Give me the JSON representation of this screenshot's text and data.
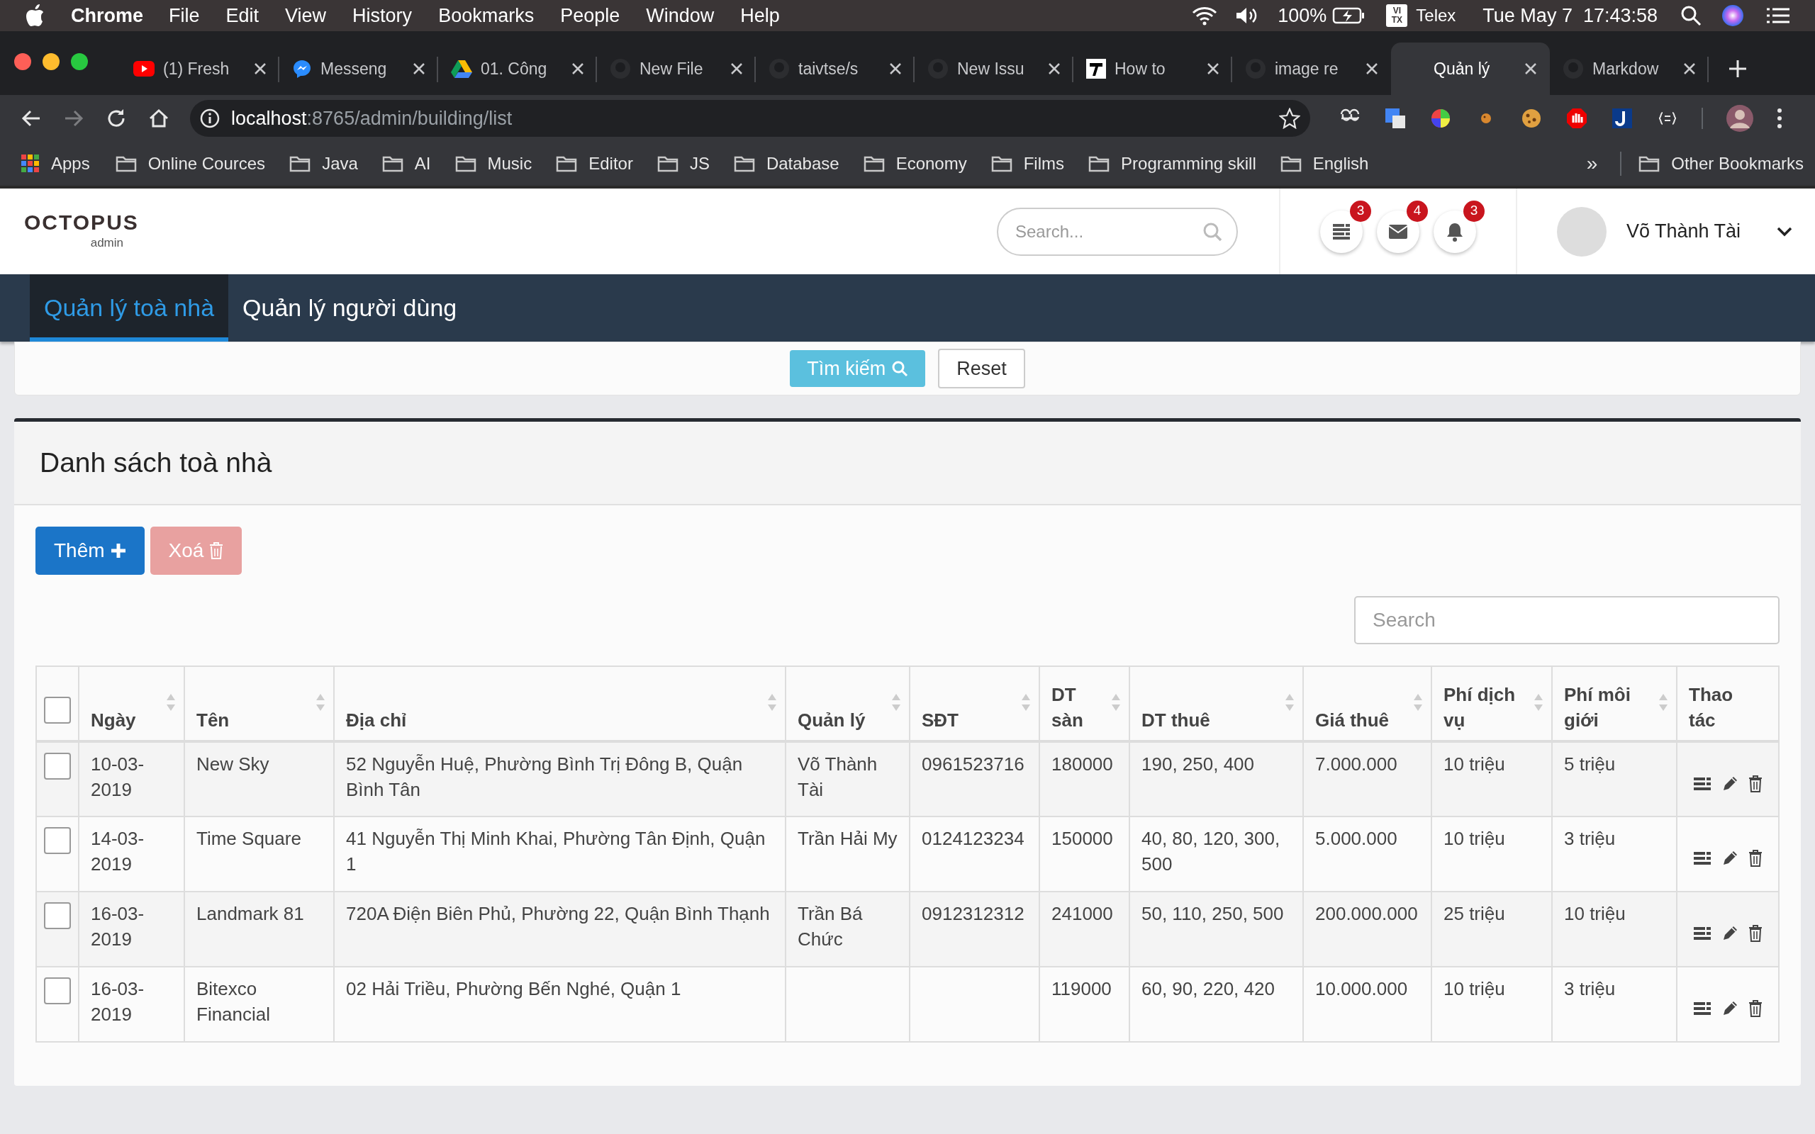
{
  "menubar": {
    "app": "Chrome",
    "menus": [
      "File",
      "Edit",
      "View",
      "History",
      "Bookmarks",
      "People",
      "Window",
      "Help"
    ],
    "battery": "100%",
    "input_badge": [
      "VI",
      "TX"
    ],
    "input_method": "Telex",
    "clock": "Tue May 7  17:43:58"
  },
  "tabs": [
    {
      "title": "(1) Fresh",
      "kind": "video",
      "selected": false
    },
    {
      "title": "Messeng",
      "kind": "chat",
      "selected": false
    },
    {
      "title": "01. Công",
      "kind": "drive",
      "selected": false
    },
    {
      "title": "New File",
      "kind": "repo",
      "selected": false
    },
    {
      "title": "taivtse/s",
      "kind": "repo",
      "selected": false
    },
    {
      "title": "New Issu",
      "kind": "repo",
      "selected": false
    },
    {
      "title": "How to",
      "kind": "letter",
      "selected": false
    },
    {
      "title": "image re",
      "kind": "repo",
      "selected": false
    },
    {
      "title": "Quản lý",
      "kind": "blank",
      "selected": true
    },
    {
      "title": "Markdow",
      "kind": "repo",
      "selected": false
    }
  ],
  "address": {
    "host": "localhost",
    "path": ":8765/admin/building/list"
  },
  "bookmarks": {
    "apps": "Apps",
    "folders": [
      "Online Cources",
      "Java",
      "AI",
      "Music",
      "Editor",
      "JS",
      "Database",
      "Economy",
      "Films",
      "Programming skill",
      "English"
    ],
    "overflow": "»",
    "other": "Other Bookmarks"
  },
  "header": {
    "logo": "OCTOPUS",
    "logo_sub": "admin",
    "search_placeholder": "Search...",
    "notifications": [
      {
        "kind": "list",
        "count": "3"
      },
      {
        "kind": "mail",
        "count": "4"
      },
      {
        "kind": "bell",
        "count": "3"
      }
    ],
    "user": "Võ Thành Tài"
  },
  "nav": [
    {
      "label": "Quản lý toà nhà",
      "selected": true
    },
    {
      "label": "Quản lý người dùng",
      "selected": false
    }
  ],
  "search_panel": {
    "buttons": [
      "Tìm kiếm",
      "Reset"
    ]
  },
  "card": {
    "title": "Danh sách toà nhà",
    "add_button": "Thêm",
    "delete_button": {
      "label": "Xoá",
      "disabled": true
    },
    "search_placeholder": "Search"
  },
  "table": {
    "all_checked": false,
    "columns": [
      {
        "label": "Ngày",
        "sortable": true
      },
      {
        "label": "Tên",
        "sortable": true
      },
      {
        "label": "Địa chỉ",
        "sortable": true
      },
      {
        "label": "Quản lý",
        "sortable": true
      },
      {
        "label": "SĐT",
        "sortable": true
      },
      {
        "label": "DT sàn",
        "sortable": true
      },
      {
        "label": "DT thuê",
        "sortable": true
      },
      {
        "label": "Giá thuê",
        "sortable": true
      },
      {
        "label": "Phí dịch vụ",
        "sortable": true
      },
      {
        "label": "Phí môi giới",
        "sortable": true
      },
      {
        "label": "Thao tác",
        "sortable": false
      }
    ],
    "rows": [
      {
        "checked": false,
        "cells": [
          "10-03-2019",
          "New Sky",
          "52 Nguyễn Huệ, Phường Bình Trị Đông B, Quận Bình Tân",
          "Võ Thành Tài",
          "0961523716",
          "180000",
          "190, 250, 400",
          "7.000.000",
          "10 triệu",
          "5 triệu"
        ]
      },
      {
        "checked": false,
        "cells": [
          "14-03-2019",
          "Time Square",
          "41 Nguyễn Thị Minh Khai, Phường Tân Định, Quận 1",
          "Trần Hải My",
          "0124123234",
          "150000",
          "40, 80, 120, 300, 500",
          "5.000.000",
          "10 triệu",
          "3 triệu"
        ]
      },
      {
        "checked": false,
        "cells": [
          "16-03-2019",
          "Landmark 81",
          "720A Điện Biên Phủ, Phường 22, Quận Bình Thạnh",
          "Trần Bá Chức",
          "0912312312",
          "241000",
          "50, 110, 250, 500",
          "200.000.000",
          "25 triệu",
          "10 triệu"
        ]
      },
      {
        "checked": false,
        "cells": [
          "16-03-2019",
          "Bitexco Financial",
          "02 Hải Triều, Phường Bến Nghé, Quận 1",
          "",
          "",
          "119000",
          "60, 90, 220, 420",
          "10.000.000",
          "10 triệu",
          "3 triệu"
        ]
      }
    ]
  }
}
